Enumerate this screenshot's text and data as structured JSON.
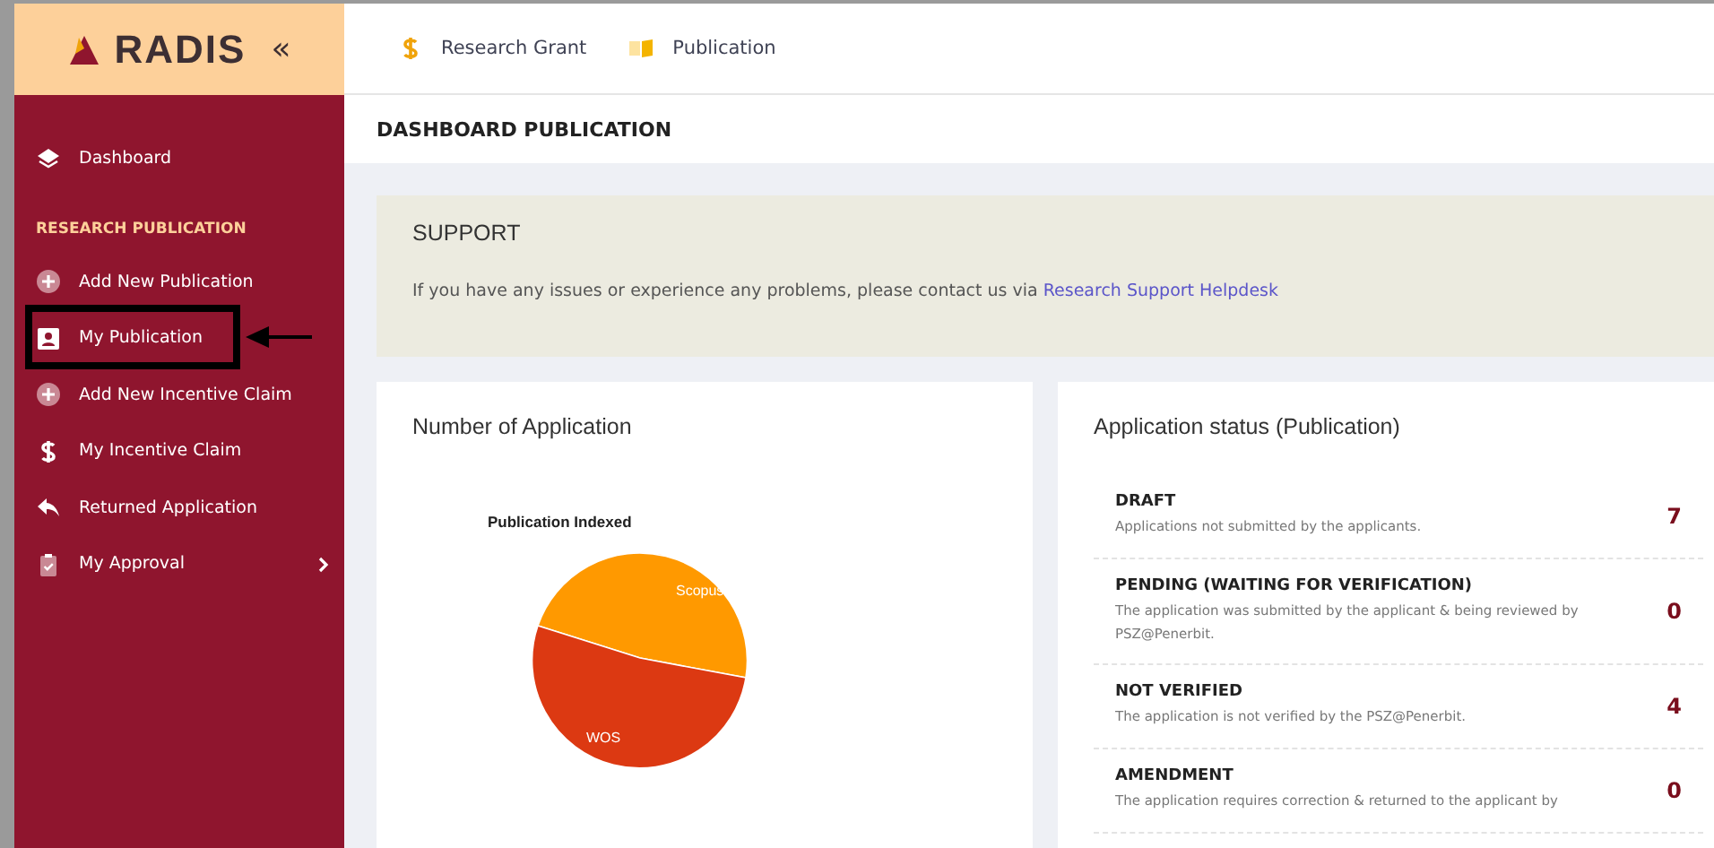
{
  "brand": {
    "name": "RADIS",
    "collapse": "«"
  },
  "top_nav": [
    {
      "label": "Research Grant",
      "kind": "dollar"
    },
    {
      "label": "Publication",
      "kind": "book"
    }
  ],
  "sidebar": {
    "items": [
      {
        "label": "Dashboard",
        "kind": "layers",
        "highlighted": false,
        "has_submenu": false
      }
    ],
    "section": "RESEARCH PUBLICATION",
    "section_items": [
      {
        "label": "Add New Publication",
        "kind": "plus",
        "highlighted": false,
        "has_submenu": false
      },
      {
        "label": "My Publication",
        "kind": "person",
        "highlighted": true,
        "has_submenu": false
      },
      {
        "label": "Add New Incentive Claim",
        "kind": "plus",
        "highlighted": false,
        "has_submenu": false
      },
      {
        "label": "My Incentive Claim",
        "kind": "dollar",
        "highlighted": false,
        "has_submenu": false
      },
      {
        "label": "Returned Application",
        "kind": "reply",
        "highlighted": false,
        "has_submenu": false
      },
      {
        "label": "My Approval",
        "kind": "clipboard",
        "highlighted": false,
        "has_submenu": true
      }
    ]
  },
  "page_title": "DASHBOARD PUBLICATION",
  "support": {
    "title": "SUPPORT",
    "text": "If you have any issues or experience any problems, please contact us via",
    "link": "Research Support Helpdesk"
  },
  "applications_card": {
    "title": "Number of Application",
    "chart_title": "Publication Indexed",
    "slices": [
      {
        "label": "Scopus",
        "color": "#ff9900"
      },
      {
        "label": "WOS",
        "color": "#dc3912"
      }
    ]
  },
  "status_card": {
    "title": "Application status (Publication)",
    "rows": [
      {
        "status": "DRAFT",
        "description": "Applications not submitted by the applicants.",
        "count": "7"
      },
      {
        "status": "PENDING (WAITING FOR VERIFICATION)",
        "description": "The application was submitted by the applicant & being reviewed by PSZ@Penerbit.",
        "count": "0"
      },
      {
        "status": "NOT VERIFIED",
        "description": "The application is not verified by the PSZ@Penerbit.",
        "count": "4"
      },
      {
        "status": "AMENDMENT",
        "description": "The application requires correction & returned to the applicant by",
        "count": "0"
      }
    ]
  }
}
